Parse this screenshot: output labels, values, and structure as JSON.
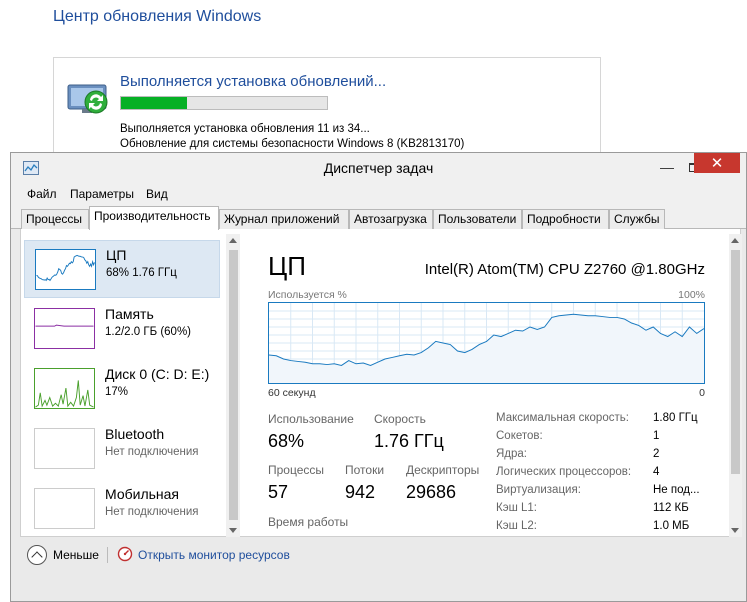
{
  "background": {
    "title": "Центр обновления Windows",
    "update": {
      "heading": "Выполняется установка обновлений...",
      "progress_fraction": 0.32,
      "line1": "Выполняется установка обновления 11 из 34...",
      "line2": "Обновление для системы безопасности Windows 8 (KB2813170)"
    }
  },
  "window": {
    "title": "Диспетчер задач",
    "menu": [
      "Файл",
      "Параметры",
      "Вид"
    ],
    "tabs": [
      "Процессы",
      "Производительность",
      "Журнал приложений",
      "Автозагрузка",
      "Пользователи",
      "Подробности",
      "Службы"
    ],
    "active_tab": "Производительность"
  },
  "sidebar": {
    "items": [
      {
        "name": "ЦП",
        "sub": "68%  1.76 ГГц",
        "color": "#1a7ac0"
      },
      {
        "name": "Память",
        "sub": "1.2/2.0 ГБ (60%)",
        "color": "#8b2fa3"
      },
      {
        "name": "Диск 0 (C: D: E:)",
        "sub": "17%",
        "color": "#4aa02c"
      },
      {
        "name": "Bluetooth",
        "sub": "Нет подключения",
        "color": "#cccccc"
      },
      {
        "name": "Мобильная",
        "sub": "Нет подключения",
        "color": "#cccccc"
      }
    ]
  },
  "cpu": {
    "title": "ЦП",
    "model": "Intel(R) Atom(TM) CPU Z2760 @1.80GHz",
    "graph_top_left": "Используется %",
    "graph_top_right": "100%",
    "graph_bottom_left": "60 секунд",
    "graph_bottom_right": "0",
    "usage_series": [
      35,
      34,
      30,
      28,
      27,
      26,
      24,
      24,
      23,
      24,
      22,
      28,
      24,
      25,
      22,
      26,
      30,
      32,
      34,
      36,
      35,
      38,
      44,
      52,
      50,
      48,
      40,
      38,
      42,
      48,
      52,
      60,
      58,
      62,
      66,
      65,
      70,
      67,
      70,
      82,
      84,
      85,
      86,
      85,
      84,
      84,
      83,
      82,
      82,
      80,
      75,
      72,
      66,
      70,
      62,
      58,
      64,
      58,
      70,
      62,
      68
    ],
    "stats": {
      "usage_label": "Использование",
      "usage_value": "68%",
      "speed_label": "Скорость",
      "speed_value": "1.76 ГГц",
      "processes_label": "Процессы",
      "processes_value": "57",
      "threads_label": "Потоки",
      "threads_value": "942",
      "handles_label": "Дескрипторы",
      "handles_value": "29686",
      "uptime_label": "Время работы"
    },
    "details": [
      {
        "key": "Максимальная скорость:",
        "value": "1.80 ГГц"
      },
      {
        "key": "Сокетов:",
        "value": "1"
      },
      {
        "key": "Ядра:",
        "value": "2"
      },
      {
        "key": "Логических процессоров:",
        "value": "4"
      },
      {
        "key": "Виртуализация:",
        "value": "Не под..."
      },
      {
        "key": "Кэш L1:",
        "value": "112 КБ"
      },
      {
        "key": "Кэш L2:",
        "value": "1.0 МБ"
      }
    ]
  },
  "footer": {
    "less_label": "Меньше",
    "monitor_link": "Открыть монитор ресурсов"
  }
}
